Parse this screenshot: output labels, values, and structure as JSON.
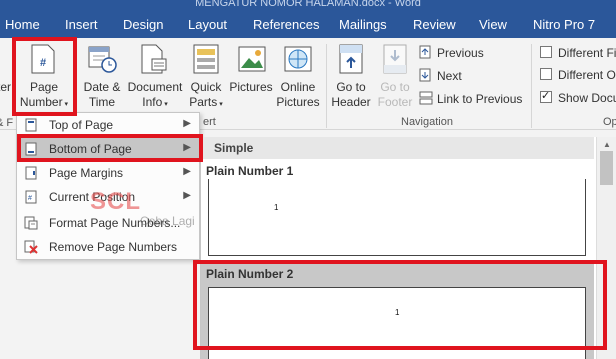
{
  "window": {
    "title": "MENGATUR NOMOR HALAMAN.docx - Word"
  },
  "tabs": [
    "Home",
    "Insert",
    "Design",
    "Layout",
    "References",
    "Mailings",
    "Review",
    "View",
    "Nitro Pro 7"
  ],
  "ribbon": {
    "page_number": {
      "line1": "Page",
      "line2": "Number"
    },
    "date_time": {
      "line1": "Date &",
      "line2": "Time"
    },
    "document_info": {
      "line1": "Document",
      "line2": "Info"
    },
    "quick_parts": {
      "line1": "Quick",
      "line2": "Parts"
    },
    "pictures": "Pictures",
    "online_pictures": {
      "line1": "Online",
      "line2": "Pictures"
    },
    "go_to_header": {
      "line1": "Go to",
      "line2": "Header"
    },
    "go_to_footer": {
      "line1": "Go to",
      "line2": "Footer"
    },
    "previous": "Previous",
    "next": "Next",
    "link_to_previous": "Link to Previous",
    "different_first": "Different Fi",
    "different_odd": "Different O",
    "show_doc": "Show Docu",
    "navigation_group": "Navigation",
    "insert_group_tail": "ert",
    "options_group_tail": "Op",
    "left_partial_1": "ter",
    "left_partial_2": "& F"
  },
  "menu": {
    "items": [
      {
        "label": "Top of Page",
        "icon": "top-of-page-icon",
        "has_submenu": true
      },
      {
        "label": "Bottom of Page",
        "icon": "bottom-of-page-icon",
        "has_submenu": true,
        "active": true
      },
      {
        "label": "Page Margins",
        "icon": "page-margins-icon",
        "has_submenu": true
      },
      {
        "label": "Current Position",
        "icon": "current-position-icon",
        "has_submenu": true
      },
      {
        "label": "Format Page Numbers...",
        "icon": "format-page-numbers-icon",
        "has_submenu": false
      },
      {
        "label": "Remove Page Numbers",
        "icon": "remove-page-numbers-icon",
        "has_submenu": false
      }
    ]
  },
  "gallery": {
    "section": "Simple",
    "items": [
      {
        "title": "Plain Number 1",
        "number": "1"
      },
      {
        "title": "Plain Number 2",
        "number": "1"
      }
    ]
  },
  "watermark": {
    "brand": "SCL",
    "text": "Coba Lagi"
  },
  "colors": {
    "ribbon_blue": "#2b579a",
    "highlight_red": "#e0141e",
    "accent_page_icon": "#2b579a"
  }
}
